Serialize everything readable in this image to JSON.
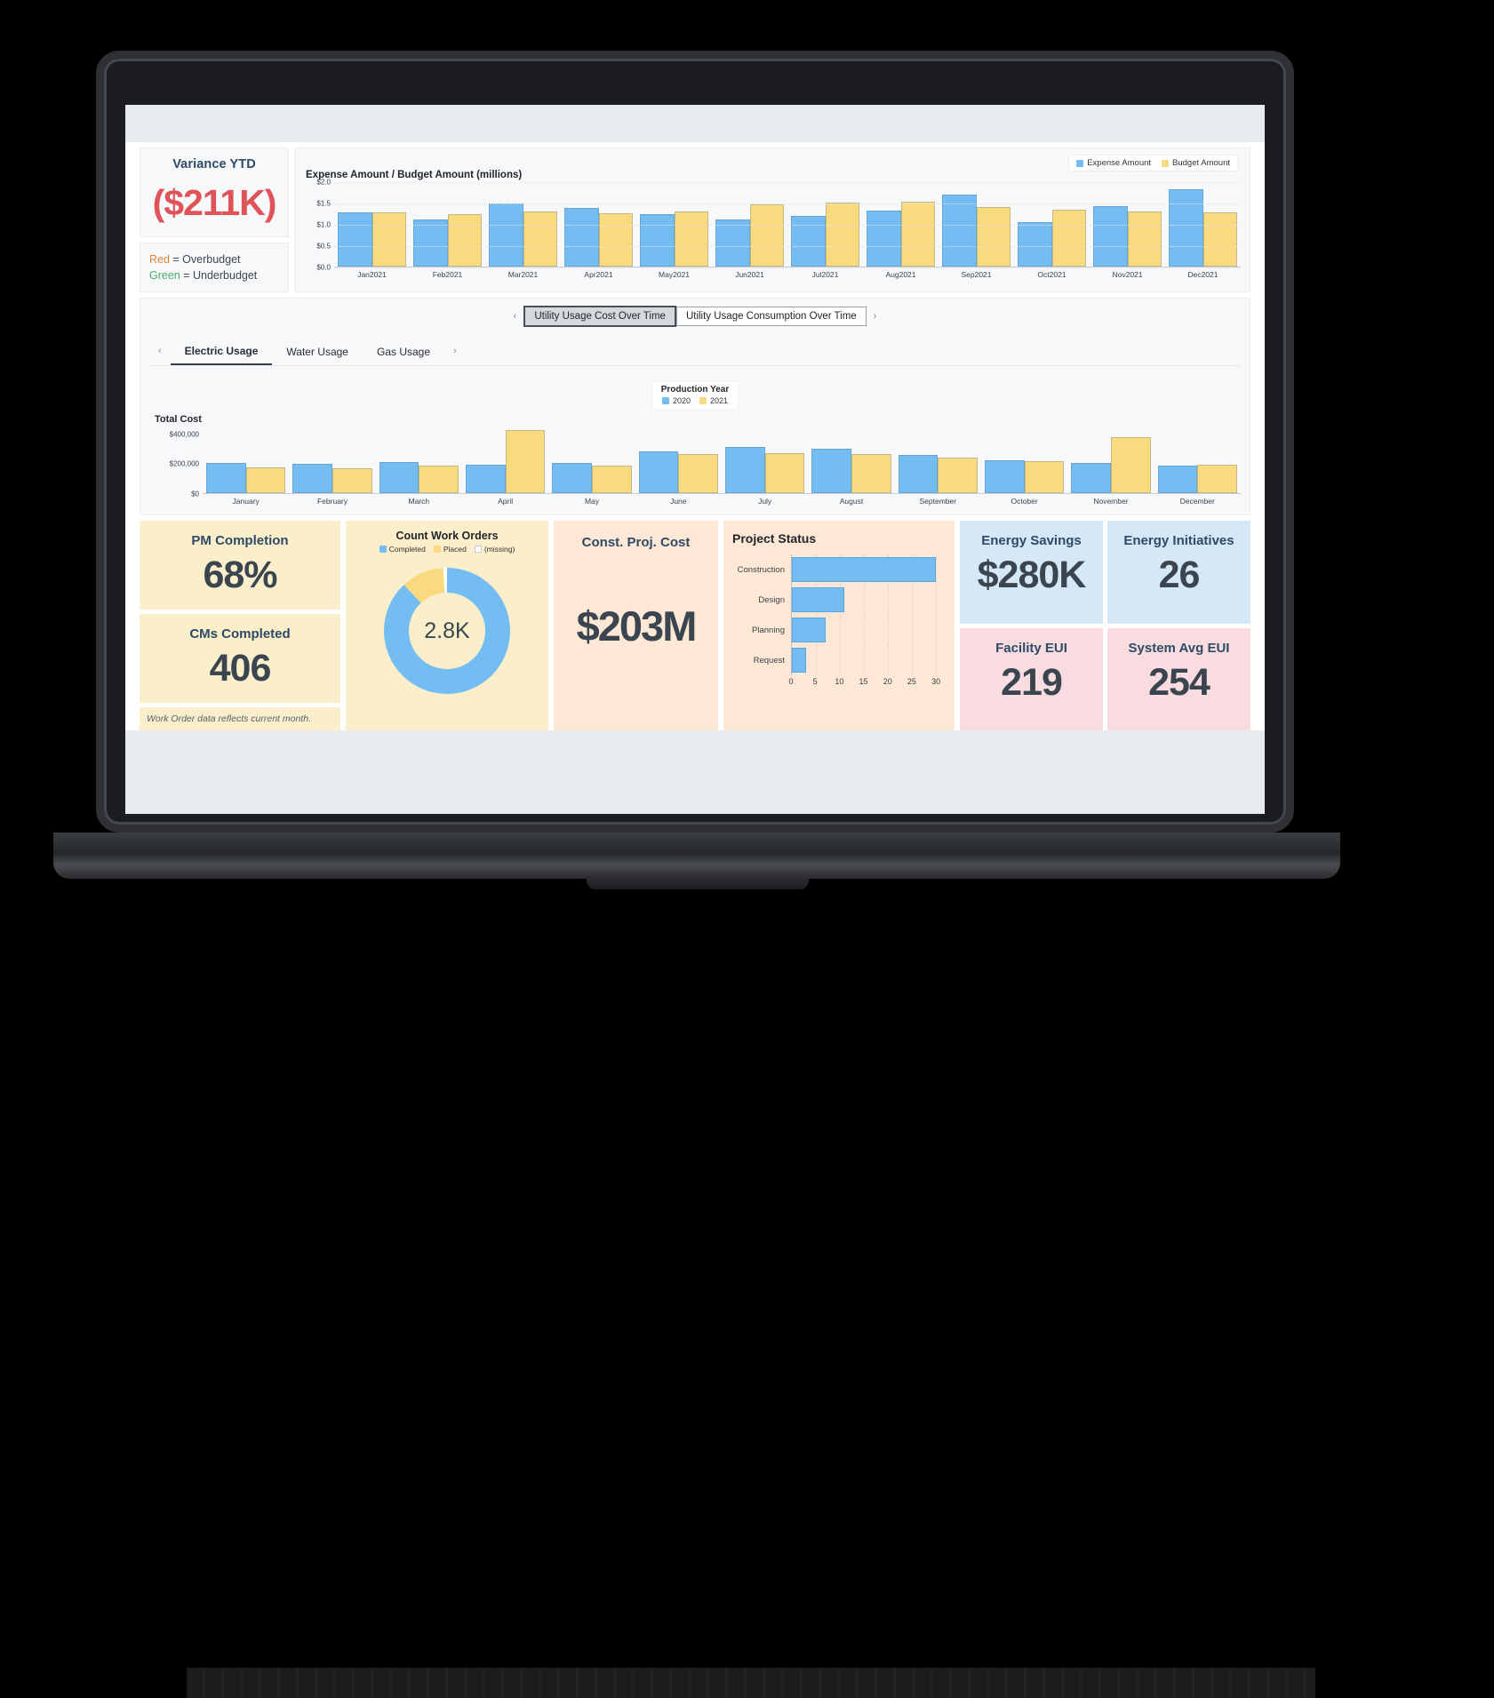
{
  "variance": {
    "title": "Variance YTD",
    "value": "($211K)",
    "legend_red_word": "Red",
    "legend_red_text": " = Overbudget",
    "legend_green_word": "Green",
    "legend_green_text": " = Underbudget",
    "red_color": "#de5459",
    "orange_color": "#e0833a",
    "green_color": "#4bae6a"
  },
  "expense_chart": {
    "legend": [
      "Expense Amount",
      "Budget Amount"
    ],
    "blue": "#74bdf2",
    "yellow": "#fada7e"
  },
  "utility": {
    "top_tabs": [
      "Utility Usage Cost Over Time",
      "Utility Usage Consumption Over Time"
    ],
    "top_tab_active": "Utility Usage Cost Over Time",
    "sub_tabs": [
      "Electric Usage",
      "Water Usage",
      "Gas Usage"
    ],
    "sub_tab_active": "Electric Usage",
    "legend_title": "Production Year",
    "legend_items": [
      "2020",
      "2021"
    ],
    "prev_arrow": "‹",
    "next_arrow": "›"
  },
  "kpis": {
    "pm_completion": {
      "title": "PM Completion",
      "value": "68%"
    },
    "cms_completed": {
      "title": "CMs Completed",
      "value": "406"
    },
    "footnote": "Work Order data reflects current month.",
    "work_orders": {
      "title": "Count Work Orders",
      "center": "2.8K",
      "legend": [
        "Completed",
        "Placed",
        "(missing)"
      ]
    },
    "const_proj_cost": {
      "title": "Const. Proj. Cost",
      "value": "$203M"
    },
    "energy_savings": {
      "title": "Energy Savings",
      "value": "$280K"
    },
    "energy_initiatives": {
      "title": "Energy Initiatives",
      "value": "26"
    },
    "facility_eui": {
      "title": "Facility EUI",
      "value": "219"
    },
    "system_avg_eui": {
      "title": "System Avg EUI",
      "value": "254"
    }
  },
  "project_status": {
    "title": "Project Status"
  },
  "chart_data": [
    {
      "type": "bar",
      "id": "expense-vs-budget",
      "title": "Expense Amount / Budget Amount (millions)",
      "categories": [
        "Jan2021",
        "Feb2021",
        "Mar2021",
        "Apr2021",
        "May2021",
        "Jun2021",
        "Jul2021",
        "Aug2021",
        "Sep2021",
        "Oct2021",
        "Nov2021",
        "Dec2021"
      ],
      "series": [
        {
          "name": "Expense Amount",
          "color": "#74bdf2",
          "values": [
            1.28,
            1.11,
            1.47,
            1.38,
            1.22,
            1.1,
            1.18,
            1.31,
            1.68,
            1.05,
            1.42,
            1.82
          ]
        },
        {
          "name": "Budget Amount",
          "color": "#fada7e",
          "values": [
            1.28,
            1.22,
            1.3,
            1.25,
            1.3,
            1.45,
            1.5,
            1.52,
            1.4,
            1.33,
            1.3,
            1.28
          ]
        }
      ],
      "ylabel": "",
      "xlabel": "",
      "yticks": [
        "$0.0",
        "$0.5",
        "$1.0",
        "$1.5",
        "$2.0"
      ],
      "ylim": [
        0,
        2.0
      ],
      "grid": true,
      "legend_position": "top-right"
    },
    {
      "type": "bar",
      "id": "utility-total-cost",
      "title": "Total Cost",
      "categories": [
        "January",
        "February",
        "March",
        "April",
        "May",
        "June",
        "July",
        "August",
        "September",
        "October",
        "November",
        "December"
      ],
      "series": [
        {
          "name": "2020",
          "color": "#74bdf2",
          "values": [
            205000,
            197000,
            210000,
            192000,
            200000,
            282000,
            308000,
            297000,
            258000,
            222000,
            205000,
            185000
          ]
        },
        {
          "name": "2021",
          "color": "#fada7e",
          "values": [
            172000,
            170000,
            188000,
            420000,
            186000,
            262000,
            270000,
            265000,
            240000,
            215000,
            375000,
            190000
          ]
        }
      ],
      "ylabel": "Total Cost",
      "xlabel": "",
      "yticks": [
        "$0",
        "$200,000",
        "$400,000"
      ],
      "ylim": [
        0,
        450000
      ],
      "grid": false,
      "legend_position": "top-center"
    },
    {
      "type": "bar",
      "id": "project-status",
      "orientation": "horizontal",
      "title": "Project Status",
      "categories": [
        "Construction",
        "Design",
        "Planning",
        "Request"
      ],
      "values": [
        30,
        11,
        7,
        3
      ],
      "color": "#74bdf2",
      "xticks": [
        "0",
        "5",
        "10",
        "15",
        "20",
        "25",
        "30"
      ],
      "xlim": [
        0,
        32
      ],
      "ylabel": "",
      "xlabel": "",
      "grid": true
    },
    {
      "type": "pie",
      "id": "count-work-orders",
      "title": "Count Work Orders",
      "center_label": "2.8K",
      "labels": [
        "Completed",
        "Placed",
        "(missing)"
      ],
      "values": [
        88,
        11,
        1
      ],
      "colors": [
        "#74bdf2",
        "#fada7e",
        "#ffffff"
      ]
    }
  ]
}
